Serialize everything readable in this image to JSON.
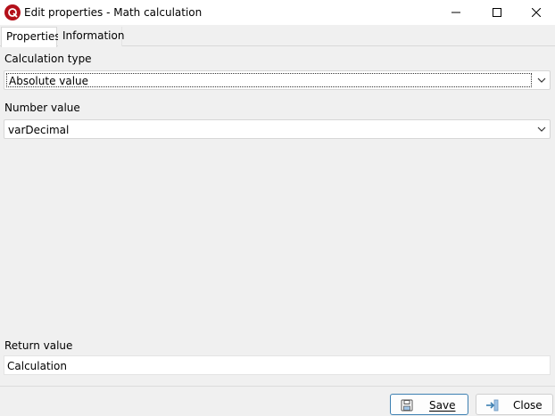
{
  "window": {
    "title": "Edit properties - Math calculation"
  },
  "tabs": [
    {
      "label": "Properties"
    },
    {
      "label": "Information"
    }
  ],
  "form": {
    "calc_type_label": "Calculation type",
    "calc_type_value": "Absolute value",
    "number_value_label": "Number value",
    "number_value_value": "varDecimal",
    "return_value_label": "Return value",
    "return_value_value": "Calculation"
  },
  "buttons": {
    "save_label": "Save",
    "close_label": "Close"
  },
  "colors": {
    "app_icon": "#b3101a",
    "save_border": "#3c7fb1"
  }
}
